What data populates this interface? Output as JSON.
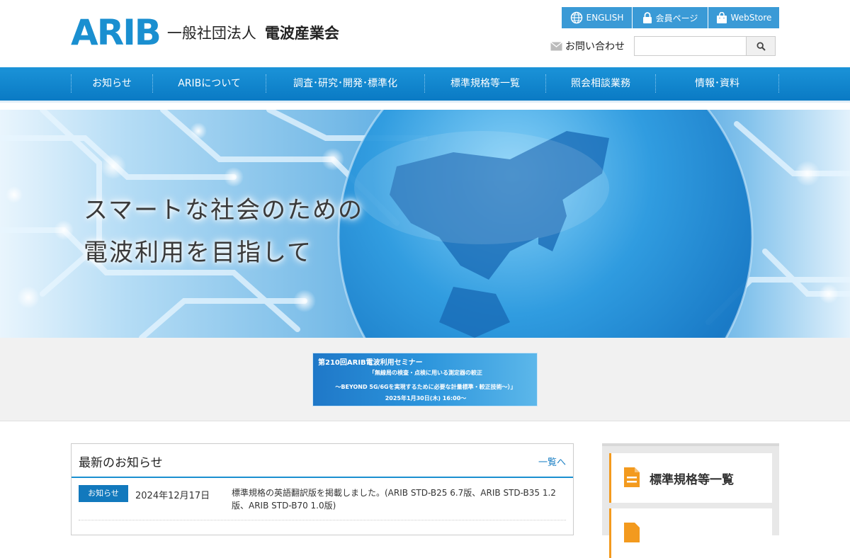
{
  "header": {
    "logo_mark": "ARIB",
    "logo_type": "一般社団法人",
    "logo_name": "電波産業会"
  },
  "utility": {
    "english": "ENGLISH",
    "members": "会員ページ",
    "webstore": "WebStore",
    "contact": "お問い合わせ"
  },
  "search": {
    "value": ""
  },
  "nav": [
    {
      "label": "お知らせ"
    },
    {
      "label": "ARIBについて"
    },
    {
      "label": "調査･研究･開発･標準化"
    },
    {
      "label": "標準規格等一覧"
    },
    {
      "label": "照会相談業務"
    },
    {
      "label": "情報･資料"
    }
  ],
  "hero": {
    "line1": "スマートな社会のための",
    "line2": "電波利用を目指して"
  },
  "banner": {
    "line1": "第210回ARIB電波利用セミナー",
    "line2": "「無線局の検査・点検に用いる測定器の較正",
    "line3": "～BEYOND 5G/6Gを実現するために必要な計量標準・較正技術～）」",
    "line4": "2025年1月30日(木) 16:00～"
  },
  "news": {
    "title": "最新のお知らせ",
    "more": "一覧へ",
    "items": [
      {
        "badge": "お知らせ",
        "date": "2024年12月17日",
        "text": "標準規格の英語翻訳版を掲載しました。(ARIB STD-B25 6.7版、ARIB STD-B35 1.2版、ARIB STD-B70 1.0版)"
      }
    ]
  },
  "sidebar": {
    "cards": [
      {
        "label": "標準規格等一覧"
      },
      {
        "label": ""
      }
    ]
  },
  "colors": {
    "brand_blue": "#1a8fd0",
    "nav_blue": "#0a7ac4",
    "accent_orange": "#f39a1e"
  },
  "icons": {
    "english": "globe-icon",
    "members": "lock-icon",
    "webstore": "shopping-bag-icon",
    "contact": "mail-icon",
    "search": "search-icon",
    "sidebar": "document-icon"
  }
}
